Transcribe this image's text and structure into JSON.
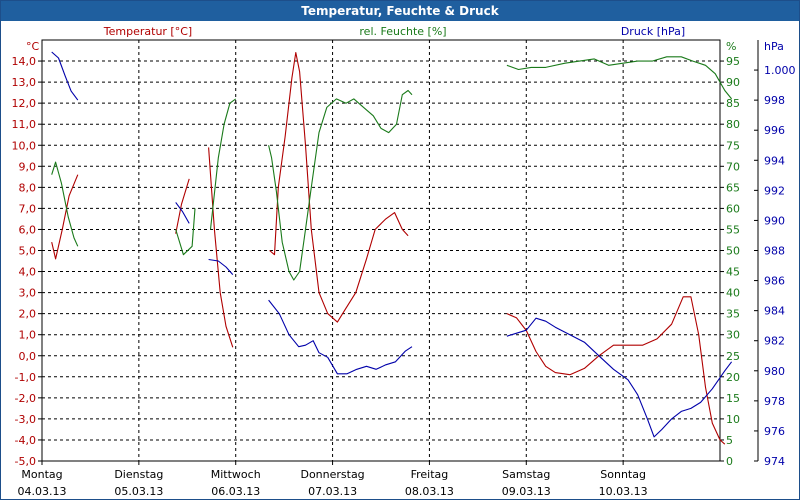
{
  "title": "Temperatur, Feuchte & Druck",
  "colors": {
    "temperature": "#b00000",
    "humidity": "#1a7a1a",
    "pressure": "#0000aa",
    "titlebar": "#1f5f9f"
  },
  "chart_data": {
    "type": "line",
    "grid": true,
    "x": {
      "range": [
        0,
        7
      ],
      "unit": "days from Montag 04.03.13 00:00"
    },
    "x_ticks": [
      {
        "day": "Montag",
        "date": "04.03.13"
      },
      {
        "day": "Dienstag",
        "date": "05.03.13"
      },
      {
        "day": "Mittwoch",
        "date": "06.03.13"
      },
      {
        "day": "Donnerstag",
        "date": "07.03.13"
      },
      {
        "day": "Freitag",
        "date": "08.03.13"
      },
      {
        "day": "Samstag",
        "date": "09.03.13"
      },
      {
        "day": "Sonntag",
        "date": "10.03.13"
      }
    ],
    "axes": {
      "temperature": {
        "unit": "°C",
        "label": "Temperatur [°C]",
        "range": [
          -5,
          15
        ],
        "ticks": [
          "14,0",
          "13,0",
          "12,0",
          "11,0",
          "10,0",
          "9,0",
          "8,0",
          "7,0",
          "6,0",
          "5,0",
          "4,0",
          "3,0",
          "2,0",
          "1,0",
          "0,0",
          "-1,0",
          "-2,0",
          "-3,0",
          "-4,0",
          "-5,0"
        ]
      },
      "humidity": {
        "unit": "%",
        "label": "rel. Feuchte [%]",
        "range": [
          0,
          100
        ],
        "ticks": [
          "95",
          "90",
          "85",
          "80",
          "75",
          "70",
          "65",
          "60",
          "55",
          "50",
          "45",
          "40",
          "35",
          "30",
          "25",
          "20",
          "15",
          "10",
          "5",
          "0"
        ]
      },
      "pressure": {
        "unit": "hPa",
        "label": "Druck [hPa]",
        "range": [
          974,
          1002
        ],
        "ticks": [
          "1.000",
          "998",
          "996",
          "994",
          "992",
          "990",
          "988",
          "986",
          "984",
          "982",
          "980",
          "978",
          "976",
          "974"
        ]
      }
    },
    "series": [
      {
        "name": "Temperatur [°C]",
        "axis": "temperature",
        "segments": [
          [
            [
              0.1,
              5.4
            ],
            [
              0.14,
              4.6
            ],
            [
              0.21,
              6.0
            ],
            [
              0.28,
              7.6
            ],
            [
              0.37,
              8.6
            ]
          ],
          [
            [
              1.38,
              5.8
            ],
            [
              1.44,
              7.2
            ],
            [
              1.52,
              8.4
            ]
          ],
          [
            [
              1.72,
              9.9
            ],
            [
              1.78,
              6.0
            ],
            [
              1.84,
              3.0
            ],
            [
              1.9,
              1.4
            ],
            [
              1.97,
              0.4
            ]
          ],
          [
            [
              2.35,
              5.0
            ],
            [
              2.4,
              4.8
            ],
            [
              2.44,
              8.0
            ],
            [
              2.51,
              10.4
            ],
            [
              2.58,
              13.2
            ],
            [
              2.62,
              14.4
            ],
            [
              2.66,
              13.5
            ],
            [
              2.72,
              10.0
            ],
            [
              2.78,
              6.0
            ],
            [
              2.86,
              3.0
            ],
            [
              2.95,
              2.0
            ],
            [
              3.05,
              1.6
            ],
            [
              3.13,
              2.2
            ],
            [
              3.24,
              3.0
            ],
            [
              3.35,
              4.6
            ],
            [
              3.44,
              6.0
            ],
            [
              3.55,
              6.5
            ],
            [
              3.64,
              6.8
            ],
            [
              3.72,
              6.0
            ],
            [
              3.78,
              5.7
            ]
          ],
          [
            [
              4.8,
              2.0
            ],
            [
              4.9,
              1.8
            ],
            [
              5.0,
              1.2
            ],
            [
              5.1,
              0.2
            ],
            [
              5.2,
              -0.5
            ],
            [
              5.3,
              -0.8
            ],
            [
              5.45,
              -0.9
            ],
            [
              5.6,
              -0.6
            ],
            [
              5.75,
              0.0
            ],
            [
              5.9,
              0.5
            ],
            [
              6.05,
              0.5
            ],
            [
              6.2,
              0.5
            ],
            [
              6.35,
              0.8
            ],
            [
              6.5,
              1.5
            ],
            [
              6.62,
              2.8
            ],
            [
              6.7,
              2.8
            ],
            [
              6.78,
              1.0
            ],
            [
              6.85,
              -1.5
            ],
            [
              6.92,
              -3.2
            ],
            [
              7.0,
              -4.0
            ],
            [
              7.05,
              -4.2
            ]
          ]
        ]
      },
      {
        "name": "rel. Feuchte [%]",
        "axis": "humidity",
        "segments": [
          [
            [
              0.1,
              68
            ],
            [
              0.14,
              71
            ],
            [
              0.2,
              66
            ],
            [
              0.27,
              58
            ],
            [
              0.33,
              53
            ],
            [
              0.37,
              51
            ]
          ],
          [
            [
              1.38,
              55
            ],
            [
              1.46,
              49
            ],
            [
              1.55,
              51
            ],
            [
              1.58,
              60
            ]
          ],
          [
            [
              1.74,
              55
            ],
            [
              1.82,
              72
            ],
            [
              1.88,
              80
            ],
            [
              1.94,
              85
            ],
            [
              2.0,
              86
            ]
          ],
          [
            [
              2.34,
              75
            ],
            [
              2.37,
              72
            ],
            [
              2.42,
              64
            ],
            [
              2.48,
              52
            ],
            [
              2.55,
              45
            ],
            [
              2.6,
              43
            ],
            [
              2.66,
              45
            ],
            [
              2.72,
              55
            ],
            [
              2.78,
              65
            ],
            [
              2.86,
              78
            ],
            [
              2.94,
              84
            ],
            [
              3.04,
              86
            ],
            [
              3.14,
              85
            ],
            [
              3.22,
              86
            ],
            [
              3.32,
              84
            ],
            [
              3.42,
              82
            ],
            [
              3.5,
              79
            ],
            [
              3.58,
              78
            ],
            [
              3.66,
              80
            ],
            [
              3.72,
              87
            ],
            [
              3.78,
              88
            ],
            [
              3.82,
              87
            ]
          ],
          [
            [
              4.8,
              94
            ],
            [
              4.92,
              93
            ],
            [
              5.05,
              93.5
            ],
            [
              5.2,
              93.5
            ],
            [
              5.4,
              94.5
            ],
            [
              5.55,
              95
            ],
            [
              5.7,
              95.5
            ],
            [
              5.85,
              94
            ],
            [
              6.0,
              94.5
            ],
            [
              6.15,
              95
            ],
            [
              6.3,
              95
            ],
            [
              6.45,
              96
            ],
            [
              6.6,
              96
            ],
            [
              6.72,
              95
            ],
            [
              6.85,
              94
            ],
            [
              6.95,
              92
            ],
            [
              7.05,
              88
            ],
            [
              7.12,
              86
            ]
          ]
        ]
      },
      {
        "name": "Druck [hPa]",
        "axis": "pressure",
        "segments": [
          [
            [
              0.1,
              1001.2
            ],
            [
              0.17,
              1000.8
            ],
            [
              0.24,
              999.6
            ],
            [
              0.3,
              998.6
            ],
            [
              0.37,
              998.0
            ]
          ],
          [
            [
              1.38,
              991.2
            ],
            [
              1.45,
              990.6
            ],
            [
              1.52,
              989.8
            ]
          ],
          [
            [
              1.72,
              987.4
            ],
            [
              1.82,
              987.3
            ],
            [
              1.9,
              986.9
            ],
            [
              1.97,
              986.4
            ]
          ],
          [
            [
              2.34,
              984.7
            ],
            [
              2.45,
              983.8
            ],
            [
              2.55,
              982.4
            ],
            [
              2.65,
              981.6
            ],
            [
              2.72,
              981.7
            ],
            [
              2.8,
              982.0
            ],
            [
              2.86,
              981.2
            ],
            [
              2.95,
              980.9
            ],
            [
              3.05,
              979.8
            ],
            [
              3.15,
              979.8
            ],
            [
              3.25,
              980.1
            ],
            [
              3.35,
              980.3
            ],
            [
              3.45,
              980.1
            ],
            [
              3.55,
              980.4
            ],
            [
              3.65,
              980.6
            ],
            [
              3.75,
              981.3
            ],
            [
              3.82,
              981.6
            ]
          ],
          [
            [
              4.8,
              982.3
            ],
            [
              4.9,
              982.5
            ],
            [
              5.0,
              982.7
            ],
            [
              5.1,
              983.5
            ],
            [
              5.2,
              983.3
            ],
            [
              5.3,
              982.9
            ],
            [
              5.45,
              982.4
            ],
            [
              5.6,
              981.9
            ],
            [
              5.75,
              981.0
            ],
            [
              5.9,
              980.1
            ],
            [
              6.05,
              979.4
            ],
            [
              6.15,
              978.4
            ],
            [
              6.25,
              976.8
            ],
            [
              6.32,
              975.6
            ],
            [
              6.4,
              976.1
            ],
            [
              6.5,
              976.8
            ],
            [
              6.6,
              977.3
            ],
            [
              6.7,
              977.5
            ],
            [
              6.8,
              977.9
            ],
            [
              6.92,
              978.8
            ],
            [
              7.05,
              980.0
            ],
            [
              7.12,
              980.6
            ]
          ]
        ]
      }
    ]
  }
}
